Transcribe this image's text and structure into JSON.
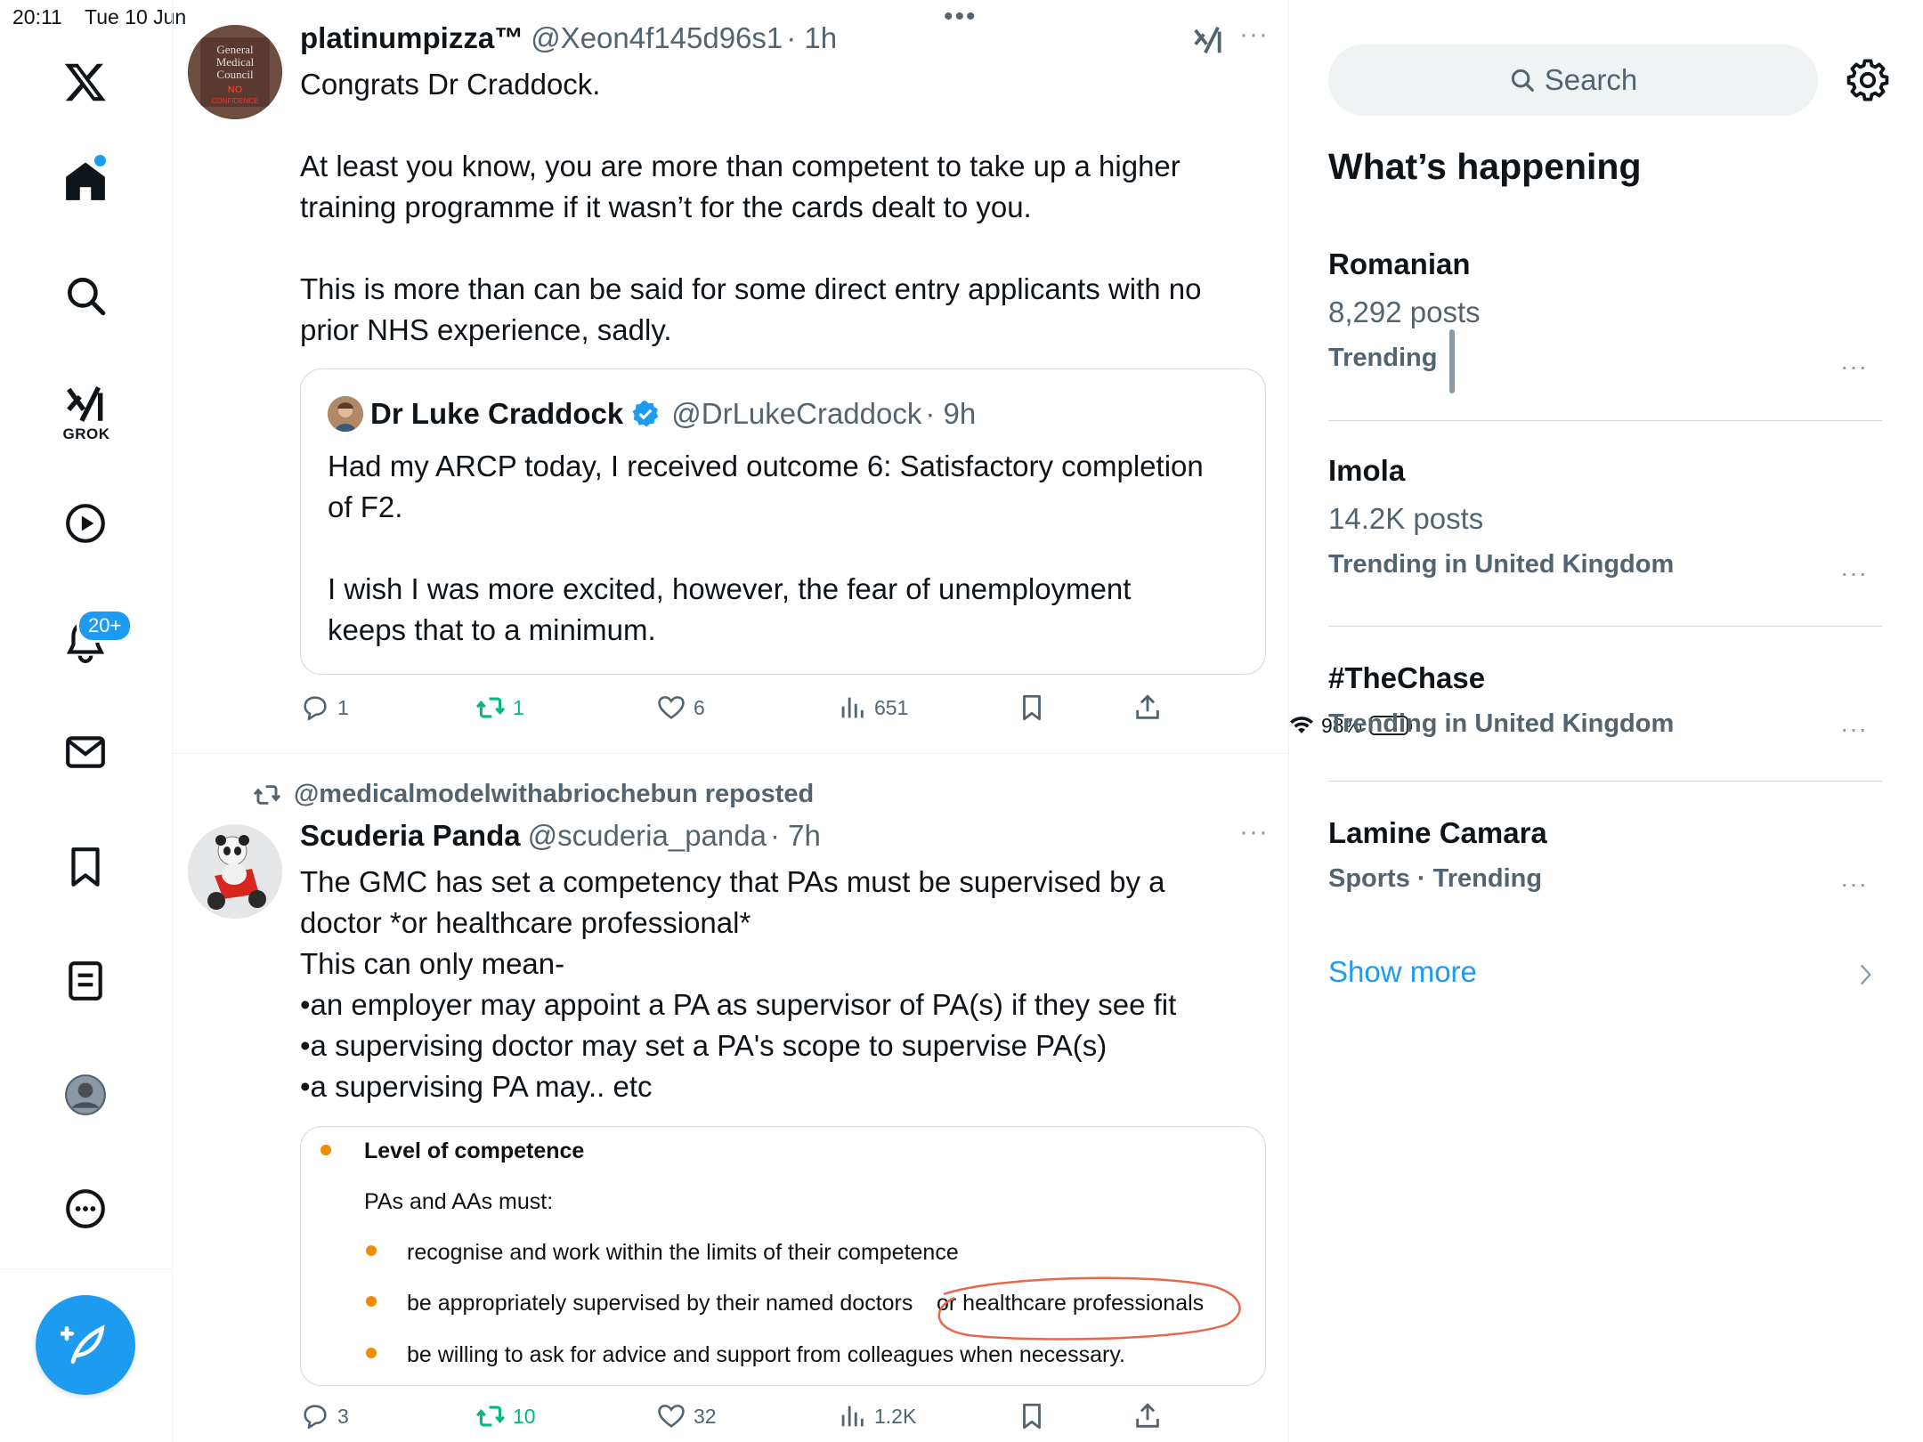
{
  "status_bar": {
    "time": "20:11",
    "date": "Tue 10 Jun",
    "battery": "98%"
  },
  "nav": {
    "grok_label": "GROK",
    "notifications_badge": "20+"
  },
  "tweet1": {
    "name": "platinumpizza™",
    "handle": "@Xeon4f145d96s1",
    "time": "· 1h",
    "line1": "Congrats Dr Craddock.",
    "line2": "At least you know, you are more than competent to take up a higher",
    "line3": "training programme if it wasn’t for the cards dealt to you.",
    "line4": "This is more than can be said for some direct entry applicants with no",
    "line5": "prior NHS experience, sadly.",
    "avatar_text": {
      "l1": "General",
      "l2": "Medical",
      "l3": "Council",
      "l4": "NO",
      "l5": "CONFIDENCE"
    },
    "quote": {
      "name": "Dr Luke Craddock",
      "handle": "@DrLukeCraddock",
      "time": "· 9h",
      "line1": "Had my ARCP today, I received outcome 6: Satisfactory completion",
      "line2": "of F2.",
      "line3": "I wish I was more excited, however, the fear of unemployment",
      "line4": "keeps that to a minimum."
    },
    "actions": {
      "replies": "1",
      "reposts": "1",
      "likes": "6",
      "views": "651"
    }
  },
  "tweet2": {
    "reposted_by": "@medicalmodelwithabriochebun reposted",
    "name": "Scuderia Panda",
    "handle": "@scuderia_panda",
    "time": "· 7h",
    "line1": "The GMC has set a competency that PAs must be supervised by a",
    "line2": "doctor *or healthcare professional*",
    "line3": "This can only mean-",
    "line4": "•an employer may appoint a PA as supervisor of PA(s) if they see fit",
    "line5": "•a supervising doctor may set a PA's scope to supervise PA(s)",
    "line6": "•a supervising PA may.. etc",
    "media": {
      "heading": "Level of competence",
      "intro": "PAs and AAs must:",
      "item1": "recognise and work within the limits of their competence",
      "item2a": "be appropriately supervised by their named doctors",
      "item2b": "or healthcare professionals",
      "item3": "be willing to ask for advice and support from colleagues when necessary."
    },
    "actions": {
      "replies": "3",
      "reposts": "10",
      "likes": "32",
      "views": "1.2K"
    }
  },
  "sidebar": {
    "search_placeholder": "Search",
    "title": "What’s happening",
    "trends": [
      {
        "name": "Romanian",
        "posts": "8,292 posts",
        "meta": "Trending"
      },
      {
        "name": "Imola",
        "posts": "14.2K posts",
        "meta": "Trending in United Kingdom"
      },
      {
        "name": "#TheChase",
        "meta": "Trending in United Kingdom"
      },
      {
        "name": "Lamine Camara",
        "meta": "Sports · Trending"
      }
    ],
    "show_more": "Show more"
  },
  "colors": {
    "accent": "#1d9bf0",
    "repost_green": "#00ba7c",
    "secondary_text": "#536471",
    "highlight_circle": "#e8664a",
    "bullet_orange": "#f08c00"
  }
}
